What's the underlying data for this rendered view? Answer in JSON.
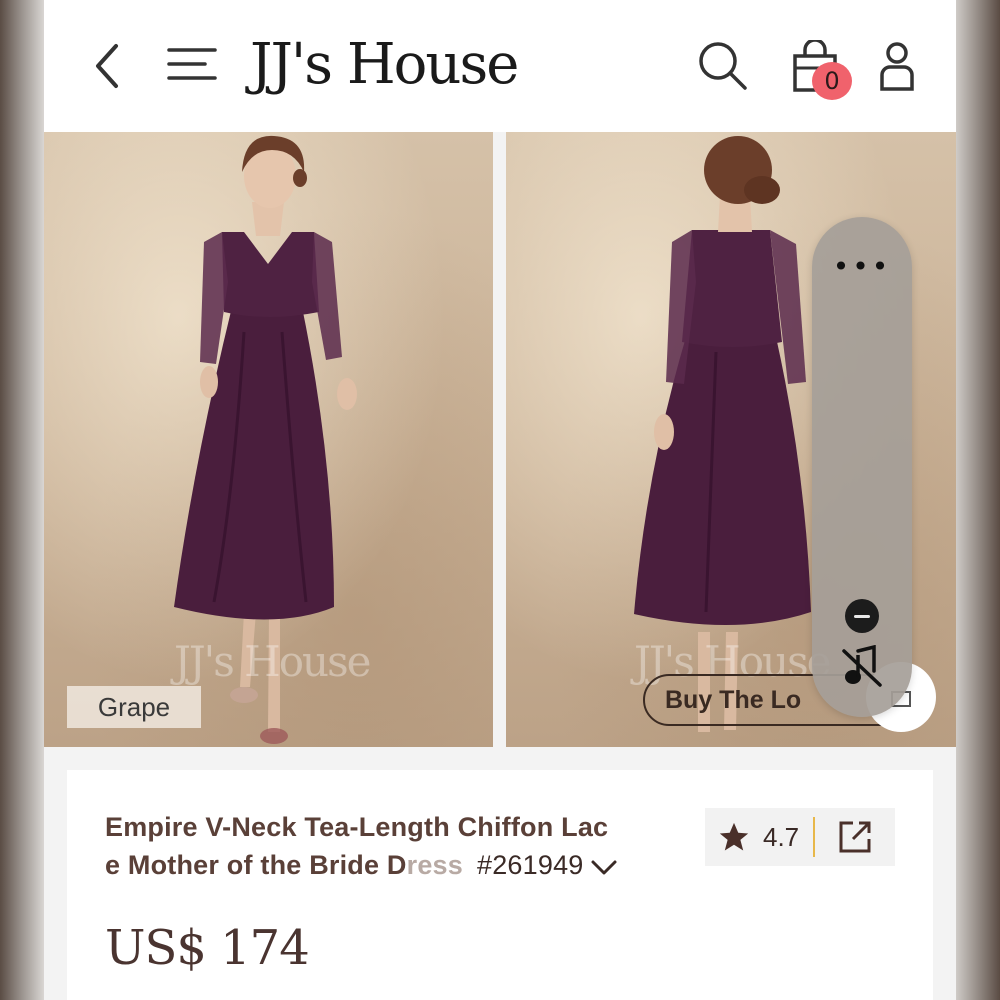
{
  "header": {
    "logo": "JJ's House",
    "cart_count": "0",
    "icons": {
      "back": "back-chevron-icon",
      "menu": "menu-icon",
      "search": "search-icon",
      "bag": "shopping-bag-icon",
      "account": "user-icon"
    }
  },
  "gallery": {
    "watermark": "JJ's House",
    "color_tag": "Grape",
    "buy_the_look": "Buy The Lo",
    "dress_color": "#4a1e3d"
  },
  "floating_panel": {
    "more": "•••",
    "icons": [
      "more-icon",
      "minus-icon",
      "mute-icon"
    ]
  },
  "product": {
    "title_line1": "Empire V-Neck Tea-Length Chiffon Lac",
    "title_line2": "e Mother of the Bride Dress",
    "sku": "#261949",
    "rating": "4.7",
    "price": "US$ 174"
  },
  "colors": {
    "badge": "#f0626c",
    "rating_separator": "#e8b84a",
    "title_text": "#5a4038"
  }
}
